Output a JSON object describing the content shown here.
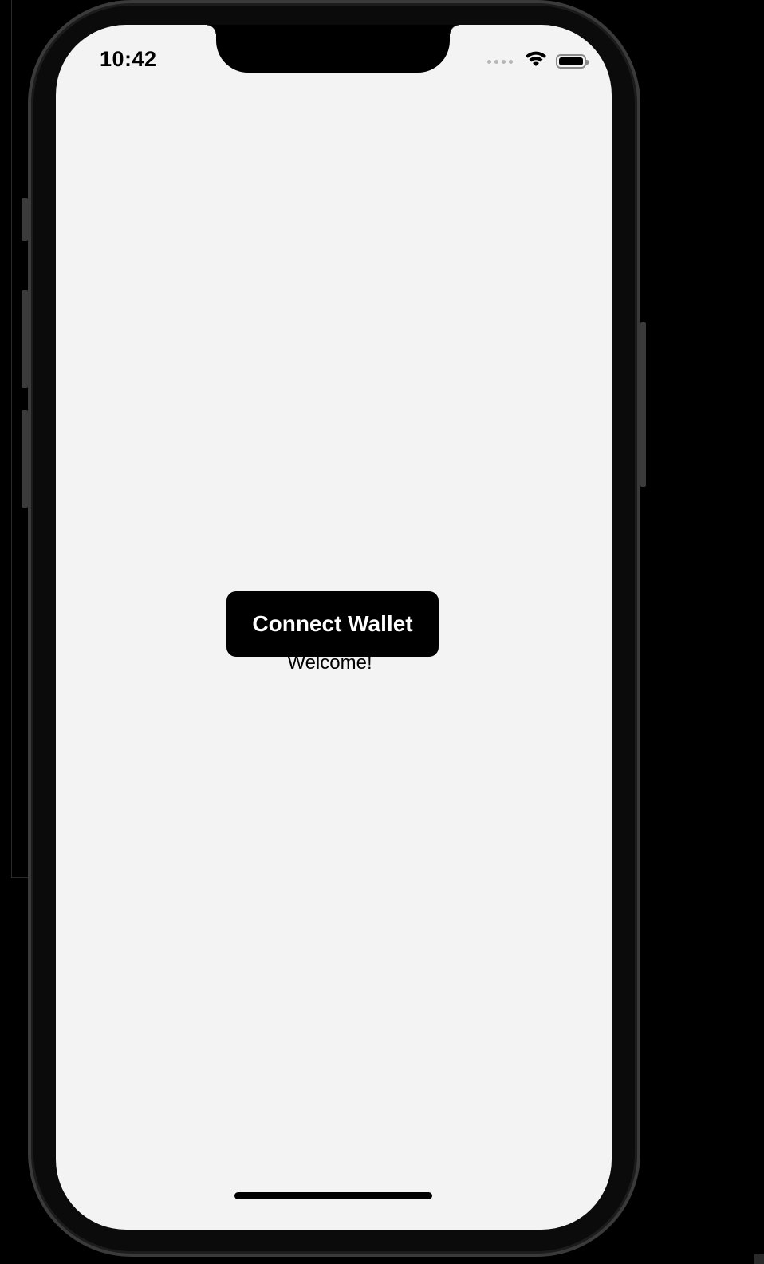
{
  "status_bar": {
    "time": "10:42",
    "signal_icon": "cellular-signal-icon",
    "wifi_icon": "wifi-icon",
    "battery_icon": "battery-icon",
    "battery_level": 1.0
  },
  "main": {
    "connect_button_label": "Connect Wallet",
    "welcome_text": "Welcome!"
  },
  "colors": {
    "screen_background": "#f3f3f3",
    "button_background": "#000000",
    "button_text": "#ffffff",
    "device_frame": "#3a3a3a"
  }
}
